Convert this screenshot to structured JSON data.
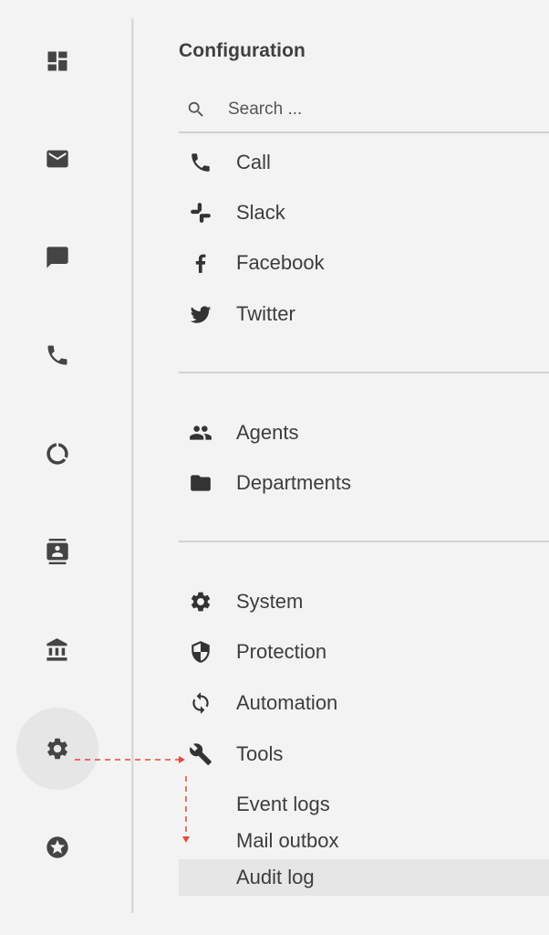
{
  "rail": {
    "items": [
      {
        "icon": "dashboard-icon"
      },
      {
        "icon": "mail-icon"
      },
      {
        "icon": "chat-icon"
      },
      {
        "icon": "phone-icon"
      },
      {
        "icon": "reports-icon"
      },
      {
        "icon": "contacts-icon"
      },
      {
        "icon": "bank-icon"
      },
      {
        "icon": "gear-icon",
        "active": true
      },
      {
        "icon": "star-icon"
      }
    ]
  },
  "panel": {
    "title": "Configuration",
    "search": {
      "placeholder": "Search ..."
    },
    "channels": {
      "partial_label": "Call",
      "slack": "Slack",
      "facebook": "Facebook",
      "twitter": "Twitter"
    },
    "org": {
      "agents": "Agents",
      "departments": "Departments"
    },
    "settings": {
      "system": "System",
      "protection": "Protection",
      "automation": "Automation",
      "tools": "Tools",
      "tools_children": {
        "event_logs": "Event logs",
        "mail_outbox": "Mail outbox",
        "audit_log": "Audit log"
      }
    },
    "selected_item": "Audit log"
  },
  "colors": {
    "background": "#f3f3f3",
    "active_rail": "#e6e6e6",
    "selected_row": "#e6e6e6",
    "annotation": "#e8473b"
  }
}
